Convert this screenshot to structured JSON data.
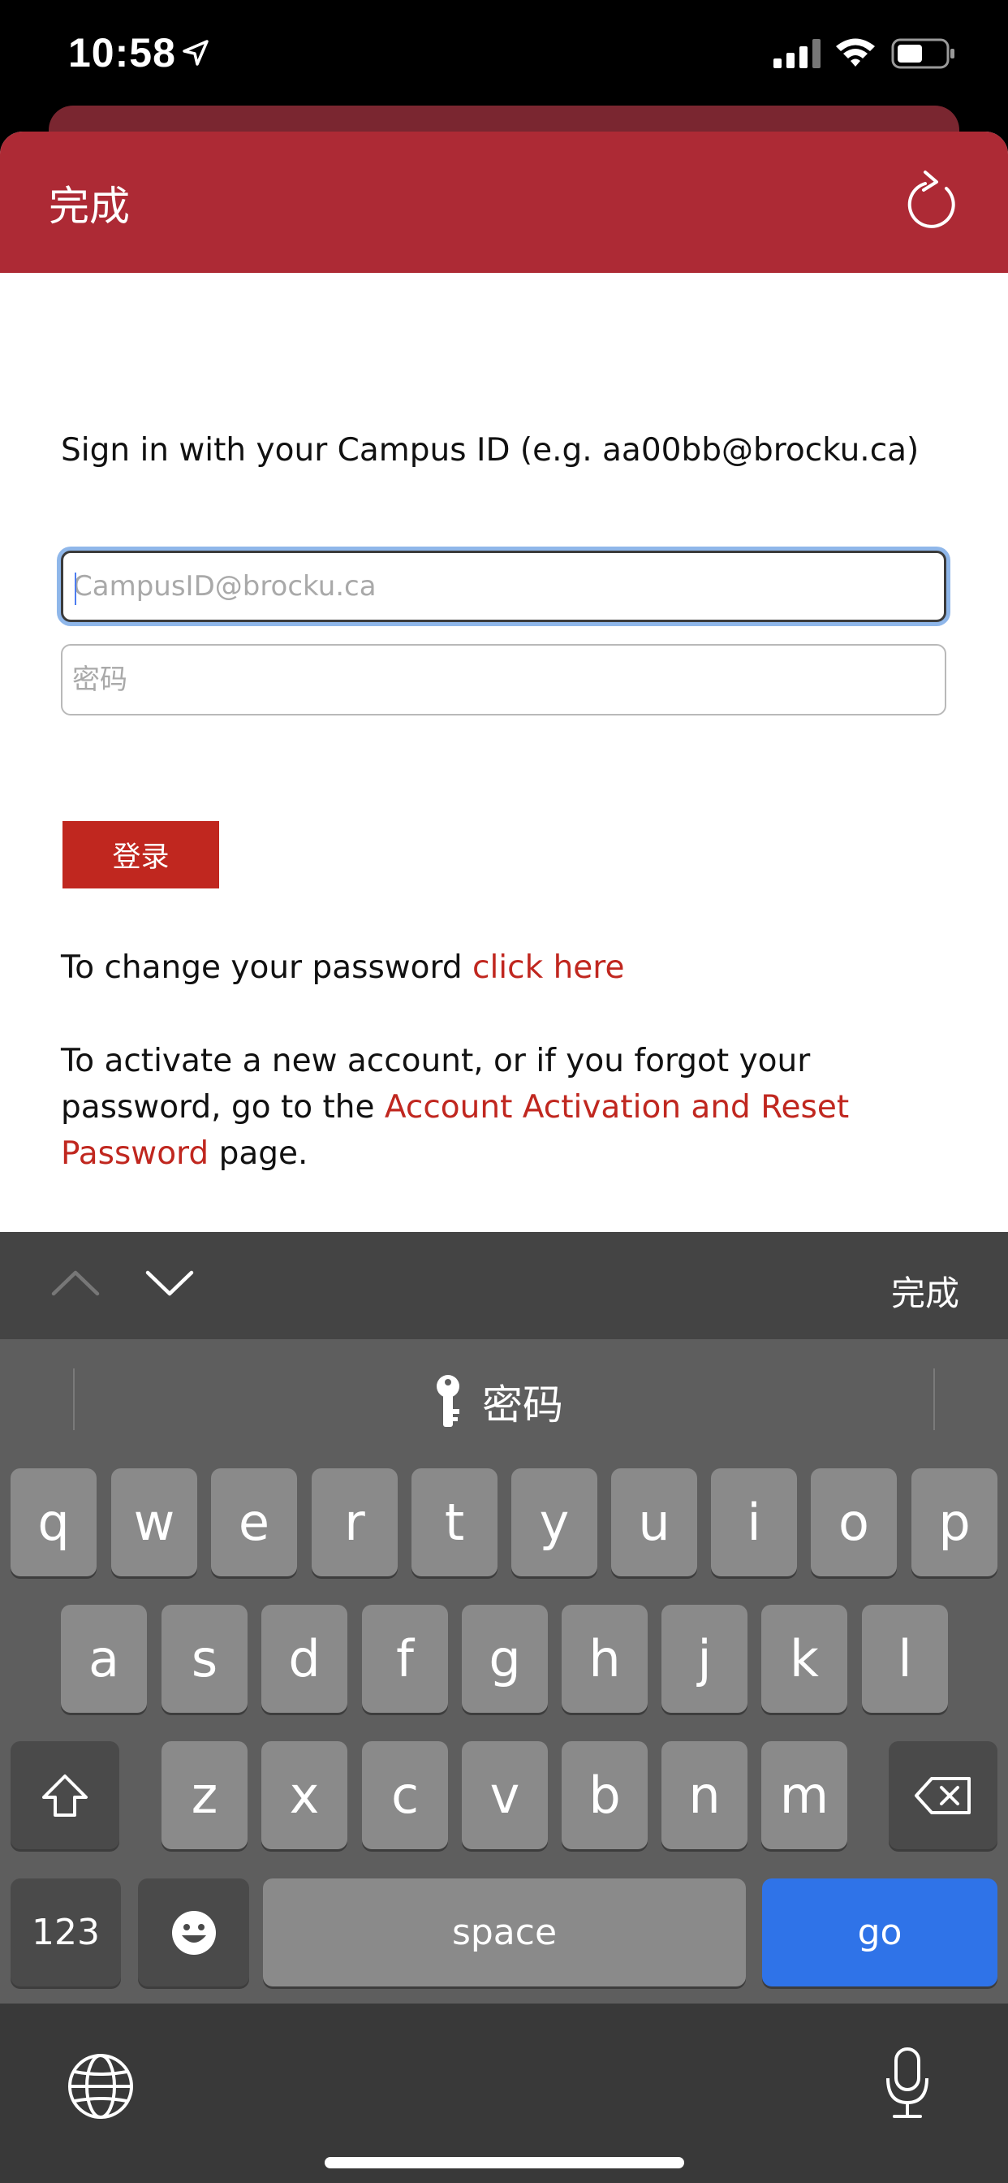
{
  "status_bar": {
    "time": "10:58"
  },
  "nav": {
    "done_label": "完成"
  },
  "form": {
    "intro": "Sign in with your Campus ID (e.g. aa00bb@brocku.ca)",
    "email_placeholder": "CampusID@brocku.ca",
    "password_placeholder": "密码",
    "login_label": "登录"
  },
  "help": {
    "change_prefix": "To change your password ",
    "change_link": "click here",
    "activate_prefix": "To activate a new account, or if you forgot your password, go to the ",
    "activate_link": "Account Activation and Reset Password",
    "activate_suffix": " page."
  },
  "accessory": {
    "done_label": "完成"
  },
  "keyboard": {
    "suggestion": "密码",
    "row1": [
      "q",
      "w",
      "e",
      "r",
      "t",
      "y",
      "u",
      "i",
      "o",
      "p"
    ],
    "row2": [
      "a",
      "s",
      "d",
      "f",
      "g",
      "h",
      "j",
      "k",
      "l"
    ],
    "row3": [
      "z",
      "x",
      "c",
      "v",
      "b",
      "n",
      "m"
    ],
    "numbers_label": "123",
    "space_label": "space",
    "go_label": "go"
  },
  "colors": {
    "brand_red": "#ad2a35",
    "link_red": "#c0271f",
    "go_blue": "#2f73e8"
  }
}
